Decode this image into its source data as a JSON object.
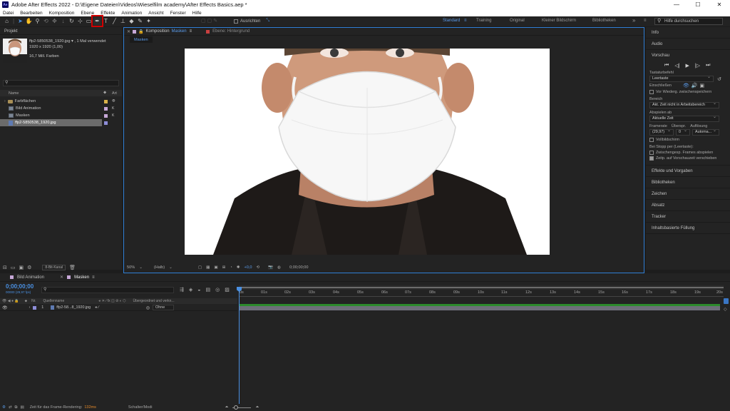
{
  "window": {
    "title": "Adobe After Effects 2022 - D:\\Eigene Dateien\\Videos\\Wieselfilm academy\\After Effects Basics.aep *",
    "app_icon": "Ae",
    "minimize": "—",
    "maximize": "☐",
    "close": "✕"
  },
  "menu": [
    "Datei",
    "Bearbeiten",
    "Komposition",
    "Ebene",
    "Effekte",
    "Animation",
    "Ansicht",
    "Fenster",
    "Hilfe"
  ],
  "toolbar": {
    "align_label": "Ausrichten",
    "workspaces": [
      "Standard",
      "Training",
      "Original",
      "Kleiner Bildschirm",
      "Bibliotheken"
    ],
    "overflow": "»",
    "search_placeholder": "Hilfe durchsuchen",
    "highlight_color": "#d00000"
  },
  "project": {
    "tab_label": "Projekt",
    "file_name": "ffp2-5850538_1920.jpg ▾ , 1 Mal verwendet",
    "file_dims": "1920 x 1920 (1,00)",
    "file_colors": "16,7 Mill. Farben",
    "col_name": "Name",
    "col_type": "Art",
    "items": [
      {
        "name": "Farbflächen",
        "type": "folder",
        "label_color": "#d8b24a"
      },
      {
        "name": "Bild Animation",
        "type": "comp",
        "label_color": "#c7a8d8"
      },
      {
        "name": "Masken",
        "type": "comp",
        "label_color": "#c7a8d8"
      },
      {
        "name": "ffp2-5850538_1920.jpg",
        "type": "image",
        "label_color": "#8d8dd8",
        "selected": true
      }
    ],
    "bpc": "8-Bit-Kanal"
  },
  "composition": {
    "tab_prefix": "Komposition",
    "tab_name": "Masken",
    "layer_tab": "Ebene: Hintergrund",
    "sub_tab": "Masken",
    "zoom": "50%",
    "resolution": "(Halb)",
    "exposure": "+0,0",
    "timecode": "0;00;00;00"
  },
  "right_panel": {
    "sections_top": [
      "Info",
      "Audio"
    ],
    "preview_title": "Vorschau",
    "shortcut_label": "Tastaturbefehl",
    "shortcut_value": "Leertaste",
    "include_label": "Einschließen",
    "cache_label": "Vor Wiederg. zwischenspeichern",
    "range_label": "Bereich",
    "range_value": "Akt. Zeit nicht in Arbeitsbereich",
    "playfrom_label": "Abspielen ab",
    "playfrom_value": "Aktuelle Zeit",
    "framerate_label": "Framerate",
    "skip_label": "Überspr.",
    "resolution_label": "Auflösung",
    "framerate_value": "(29,97)",
    "skip_value": "0",
    "resolution_value": "Automa...",
    "fullscreen_label": "Vollbildschirm",
    "stop_label": "Bei Stopp per (Leertaste):",
    "cache_frames_label": "Zwischengesp. Frames abspielen",
    "time_move_label": "Zeitp. auf Vorschauzeit verschieben",
    "sections_bottom": [
      "Effekte und Vorgaben",
      "Bibliotheken",
      "Zeichen",
      "Absatz",
      "Tracker",
      "Inhaltsbasierte Füllung"
    ]
  },
  "timeline": {
    "tabs": [
      "Bild Animation",
      "Masken"
    ],
    "timecode": "0;00;00;00",
    "fps": "00000 (29,97 fps)",
    "search_placeholder": "",
    "col_nr": "Nr.",
    "col_source": "Quellenname",
    "col_parent": "Übergeordnet und verkn...",
    "layer_index": "1",
    "layer_name": "ffp2-58...8_1920.jpg",
    "parent_value": "Ohne",
    "ticks": [
      "0s",
      "01s",
      "02s",
      "03s",
      "04s",
      "05s",
      "06s",
      "07s",
      "08s",
      "09s",
      "10s",
      "11s",
      "12s",
      "13s",
      "14s",
      "15s",
      "16s",
      "17s",
      "18s",
      "19s",
      "20s"
    ],
    "switch_mode": "Schalter/Modi"
  },
  "status": {
    "render_label": "Zeit für das Frame-Rendering:",
    "render_value": "132ms"
  }
}
